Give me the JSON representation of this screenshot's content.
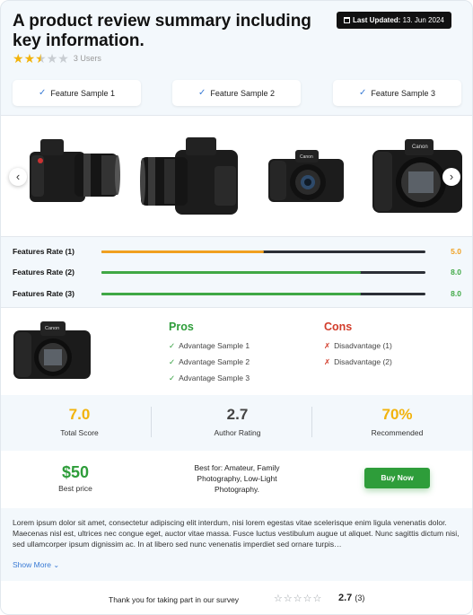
{
  "header": {
    "title": "A product review summary including key information.",
    "last_updated_label": "Last Updated:",
    "last_updated_date": "13. Jun 2024",
    "rating_value": 2.5,
    "rating_max": 5,
    "users": "3 Users"
  },
  "features": [
    "Feature Sample 1",
    "Feature Sample 2",
    "Feature Sample 3"
  ],
  "rates": [
    {
      "label": "Features Rate (1)",
      "value": "5.0",
      "fraction": 0.5,
      "color": "#f0a020"
    },
    {
      "label": "Features Rate (2)",
      "value": "8.0",
      "fraction": 0.8,
      "color": "#3fa845"
    },
    {
      "label": "Features Rate (3)",
      "value": "8.0",
      "fraction": 0.8,
      "color": "#3fa845"
    }
  ],
  "pros": {
    "title": "Pros",
    "items": [
      "Advantage Sample 1",
      "Advantage Sample 2",
      "Advantage Sample 3"
    ]
  },
  "cons": {
    "title": "Cons",
    "items": [
      "Disadvantage (1)",
      "Disadvantage (2)"
    ]
  },
  "scores": [
    {
      "value": "7.0",
      "label": "Total Score",
      "color": "#f2b30c"
    },
    {
      "value": "2.7",
      "label": "Author Rating",
      "color": "#444444"
    },
    {
      "value": "70%",
      "label": "Recommended",
      "color": "#f2b30c"
    }
  ],
  "price": {
    "value": "$50",
    "label": "Best price"
  },
  "best_for": "Best for: Amateur, Family Photography, Low-Light Photography.",
  "buy_button": "Buy Now",
  "description": "Lorem ipsum dolor sit amet, consectetur adipiscing elit interdum, nisi lorem egestas vitae scelerisque enim ligula venenatis dolor. Maecenas nisl est, ultrices nec congue eget, auctor vitae massa. Fusce luctus vestibulum augue ut aliquet. Nunc sagittis dictum nisi, sed ullamcorper ipsum dignissim ac. In at libero sed nunc venenatis imperdiet sed ornare turpis…",
  "show_more": "Show More",
  "survey": {
    "text": "Thank you for taking part in our survey",
    "average": "2.7",
    "count": "(3)"
  },
  "icons": {
    "calendar": "calendar-icon",
    "check": "check-icon",
    "prev": "chevron-left-icon",
    "next": "chevron-right-icon",
    "chevron_down": "chevron-down-icon",
    "cross": "x-icon",
    "star": "star-icon"
  },
  "colors": {
    "pros": "#2e9d3a",
    "cons": "#d23d2b",
    "accent": "#3a7bd5",
    "buy": "#2e9d3a"
  }
}
